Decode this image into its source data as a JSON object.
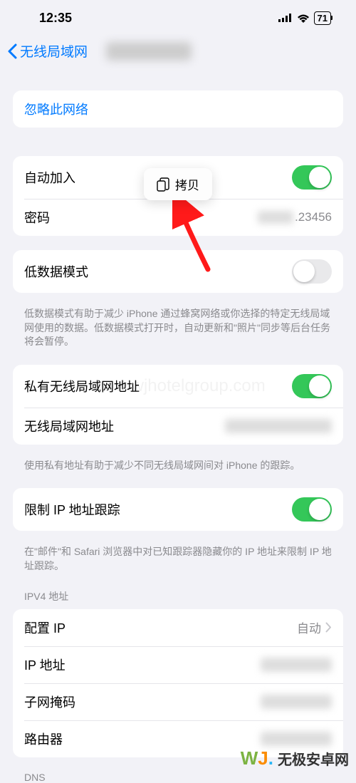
{
  "status": {
    "time": "12:35",
    "battery": "71"
  },
  "nav": {
    "back": "无线局域网"
  },
  "popover": {
    "copy": "拷贝"
  },
  "forget": {
    "label": "忽略此网络"
  },
  "auto_join": {
    "label": "自动加入"
  },
  "password": {
    "label": "密码",
    "visible_suffix": ".23456"
  },
  "low_data": {
    "label": "低数据模式",
    "note": "低数据模式有助于减少 iPhone 通过蜂窝网络或你选择的特定无线局域网使用的数据。低数据模式打开时，自动更新和\"照片\"同步等后台任务将会暂停。"
  },
  "private_addr": {
    "label": "私有无线局域网地址",
    "mac_label": "无线局域网地址",
    "note": "使用私有地址有助于减少不同无线局域网间对 iPhone 的跟踪。"
  },
  "limit_ip": {
    "label": "限制 IP 地址跟踪",
    "note": "在\"邮件\"和 Safari 浏览器中对已知跟踪器隐藏你的 IP 地址来限制 IP 地址跟踪。"
  },
  "ipv4": {
    "header": "IPV4 地址",
    "configure": "配置 IP",
    "configure_value": "自动",
    "ip_label": "IP 地址",
    "subnet_label": "子网掩码",
    "router_label": "路由器"
  },
  "dns": {
    "header": "DNS"
  },
  "watermark": {
    "center": "www.wjhotelgroup.com",
    "brand": "无极安卓网"
  }
}
